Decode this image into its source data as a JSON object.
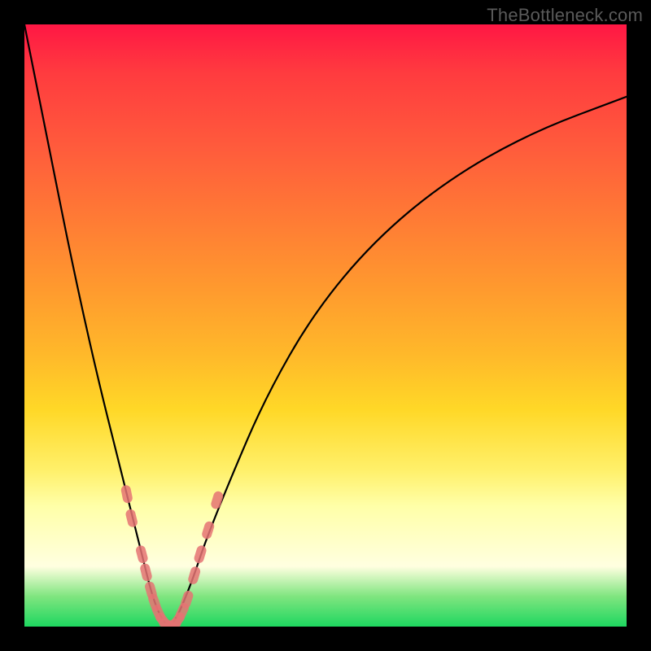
{
  "watermark": "TheBottleneck.com",
  "chart_data": {
    "type": "line",
    "title": "",
    "xlabel": "",
    "ylabel": "",
    "xlim": [
      0,
      100
    ],
    "ylim": [
      0,
      100
    ],
    "grid": false,
    "legend": false,
    "series": [
      {
        "name": "bottleneck-curve",
        "x": [
          0,
          4,
          8,
          12,
          16,
          18,
          20,
          21,
          22,
          23,
          24,
          25,
          26,
          28,
          30,
          34,
          40,
          48,
          58,
          70,
          84,
          100
        ],
        "y": [
          100,
          80,
          60,
          42,
          26,
          18,
          10,
          6,
          3,
          1,
          0,
          1,
          3,
          8,
          14,
          24,
          38,
          52,
          64,
          74,
          82,
          88
        ]
      }
    ],
    "background_gradient": {
      "direction": "vertical",
      "stops": [
        {
          "pos": 0.0,
          "color": "#ff1744"
        },
        {
          "pos": 0.32,
          "color": "#ff7a35"
        },
        {
          "pos": 0.64,
          "color": "#ffd827"
        },
        {
          "pos": 0.9,
          "color": "#ffffe0"
        },
        {
          "pos": 1.0,
          "color": "#1ed760"
        }
      ]
    },
    "markers": {
      "name": "highlighted-points",
      "color": "#e57373",
      "shape": "capsule",
      "points": [
        {
          "x": 17.0,
          "y": 22
        },
        {
          "x": 17.8,
          "y": 18
        },
        {
          "x": 19.5,
          "y": 12
        },
        {
          "x": 20.2,
          "y": 9
        },
        {
          "x": 21.0,
          "y": 6
        },
        {
          "x": 21.6,
          "y": 4
        },
        {
          "x": 22.3,
          "y": 2.2
        },
        {
          "x": 23.0,
          "y": 1.0
        },
        {
          "x": 23.8,
          "y": 0.3
        },
        {
          "x": 24.6,
          "y": 0.3
        },
        {
          "x": 25.4,
          "y": 1.0
        },
        {
          "x": 26.2,
          "y": 2.5
        },
        {
          "x": 27.0,
          "y": 4.5
        },
        {
          "x": 28.2,
          "y": 8.5
        },
        {
          "x": 29.2,
          "y": 12
        },
        {
          "x": 30.5,
          "y": 16
        },
        {
          "x": 32.0,
          "y": 21
        }
      ]
    }
  }
}
